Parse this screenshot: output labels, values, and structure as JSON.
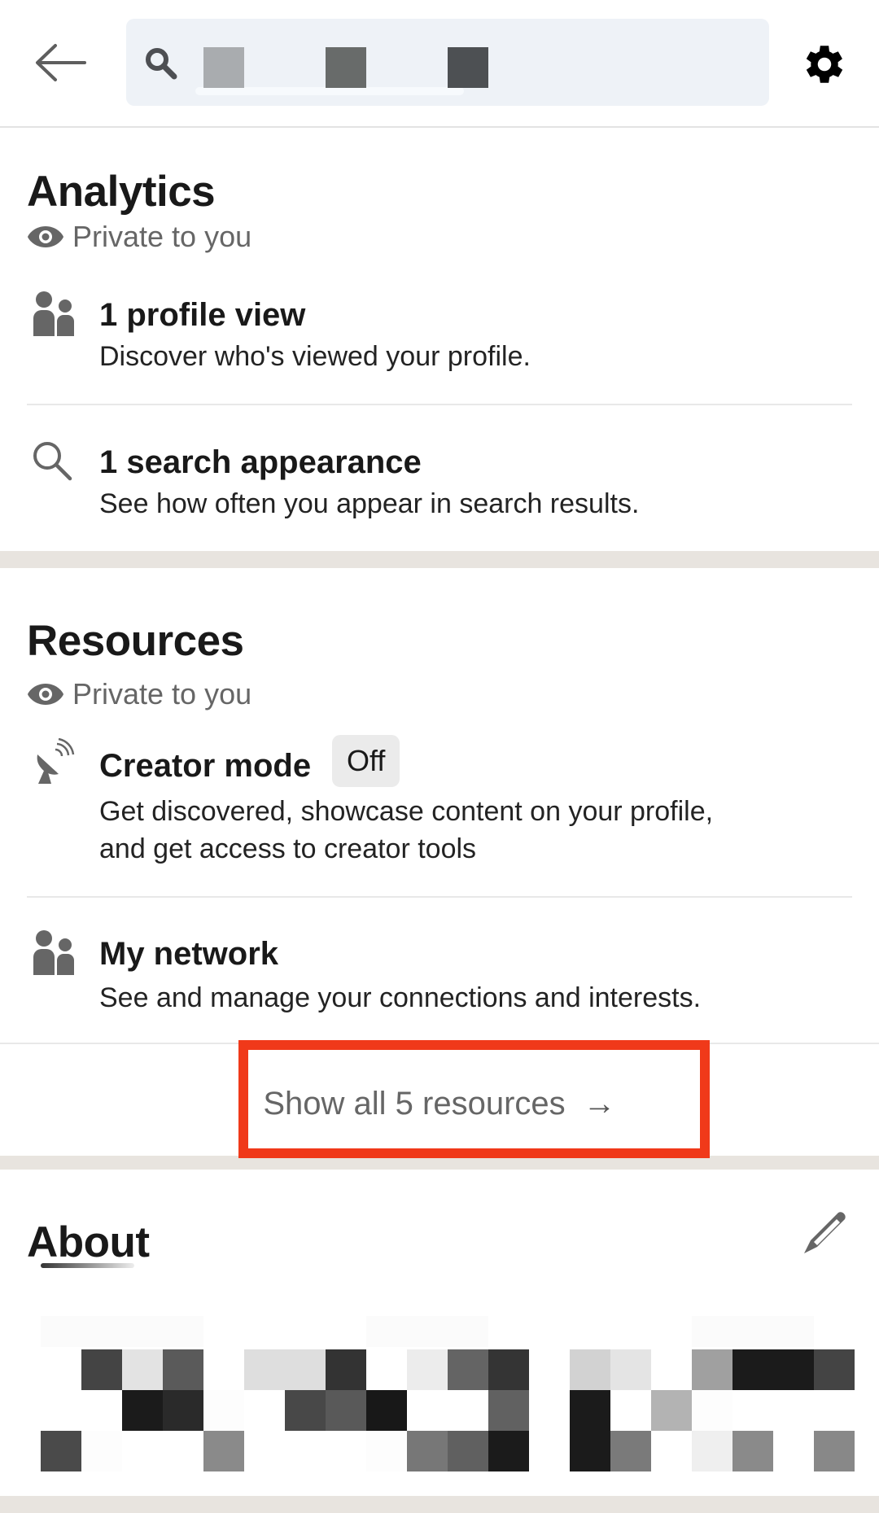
{
  "header": {
    "back_icon": "arrow-left-icon",
    "search_icon": "search-icon",
    "settings_icon": "gear-icon",
    "search_query_redacted": true,
    "redacted_blocks": [
      "#a9acaf",
      "#686b6a",
      "#4d5053"
    ]
  },
  "analytics": {
    "title": "Analytics",
    "visibility": "Private to you",
    "visibility_icon": "eye-icon",
    "items": [
      {
        "icon": "people-icon",
        "title": "1 profile view",
        "description": "Discover who's viewed your profile."
      },
      {
        "icon": "search-icon",
        "title": "1 search appearance",
        "description": "See how often you appear in search results."
      }
    ]
  },
  "resources": {
    "title": "Resources",
    "visibility": "Private to you",
    "visibility_icon": "eye-icon",
    "items": [
      {
        "icon": "satellite-dish-icon",
        "title": "Creator mode",
        "badge": "Off",
        "description_line1": "Get discovered, showcase content on your profile,",
        "description_line2": "and get access to creator tools"
      },
      {
        "icon": "people-icon",
        "title": "My network",
        "description": "See and manage your connections and interests."
      }
    ],
    "show_all_label": "Show all 5 resources",
    "show_all_arrow": "→",
    "annotation_highlight_color": "#f0391a"
  },
  "about": {
    "title": "About",
    "edit_icon": "pencil-icon",
    "content_redacted": true,
    "mosaic_rows": [
      [
        "#ffffff",
        "#444444",
        "#e3e3e3",
        "#5a5a5a",
        "#ffffff",
        "#dedede",
        "#dedede",
        "#333333",
        "#ffffff",
        "#ececec",
        "#646464",
        "#343434",
        "#ffffff",
        "#d2d2d2",
        "#e4e4e4",
        "#ffffff",
        "#a0a0a0",
        "#1b1b1b",
        "#1b1b1b",
        "#444444"
      ],
      [
        "#ffffff",
        "#ffffff",
        "#1b1b1b",
        "#2a2a2a",
        "#fdfdfd",
        "#ffffff",
        "#484848",
        "#595959",
        "#181818",
        "#ffffff",
        "#ffffff",
        "#616161",
        "#ffffff",
        "#1b1b1b",
        "#ffffff",
        "#b3b3b3",
        "#fdfdfd",
        "#ffffff",
        "#ffffff",
        "#ffffff"
      ],
      [
        "#4a4a4a",
        "#fdfdfd",
        "#ffffff",
        "#ffffff",
        "#8a8a8a",
        "#ffffff",
        "#ffffff",
        "#ffffff",
        "#fdfdfd",
        "#777777",
        "#606060",
        "#1b1b1b",
        "#ffffff",
        "#1b1b1b",
        "#7a7a7a",
        "#ffffff",
        "#efefef",
        "#8a8a8a",
        "#ffffff",
        "#888888"
      ]
    ]
  }
}
